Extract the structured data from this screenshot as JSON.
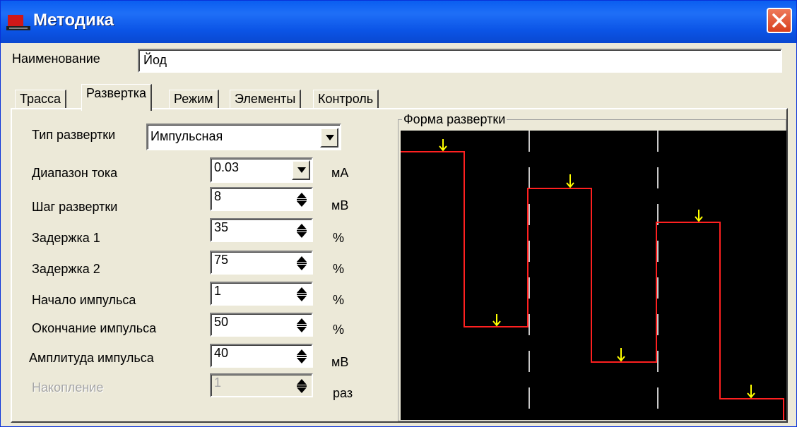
{
  "window": {
    "title": "Методика",
    "close_icon": "close-icon",
    "app_icon": "app-icon"
  },
  "name_field": {
    "label": "Наименование",
    "value": "Йод"
  },
  "tabs": [
    {
      "label": "Трасса",
      "active": false
    },
    {
      "label": "Развертка",
      "active": true
    },
    {
      "label": "Режим",
      "active": false
    },
    {
      "label": "Элементы",
      "active": false
    },
    {
      "label": "Контроль",
      "active": false
    }
  ],
  "sweep": {
    "type_label": "Тип развертки",
    "type_value": "Импульсная",
    "fields": [
      {
        "label": "Диапазон тока",
        "value": "0.03",
        "unit": "мА",
        "control": "dropdown",
        "enabled": true
      },
      {
        "label": "Шаг развертки",
        "value": "8",
        "unit": "мВ",
        "control": "spin",
        "enabled": true
      },
      {
        "label": "Задержка 1",
        "value": "35",
        "unit": "%",
        "control": "spin",
        "enabled": true
      },
      {
        "label": "Задержка 2",
        "value": "75",
        "unit": "%",
        "control": "spin",
        "enabled": true
      },
      {
        "label": "Начало импульса",
        "value": "1",
        "unit": "%",
        "control": "spin",
        "enabled": true
      },
      {
        "label": "Окончание импульса",
        "value": "50",
        "unit": "%",
        "control": "spin",
        "enabled": true
      },
      {
        "label": "Амплитуда импульса",
        "value": "40",
        "unit": "мВ",
        "control": "spin",
        "enabled": true
      },
      {
        "label": "Накопление",
        "value": "1",
        "unit": "раз",
        "control": "spin",
        "enabled": false
      }
    ]
  },
  "waveform": {
    "title": "Форма развертки",
    "colors": {
      "background": "#000000",
      "trace": "#ff0000",
      "markers": "#ffff00",
      "dividers": "#c8c8c8"
    }
  }
}
